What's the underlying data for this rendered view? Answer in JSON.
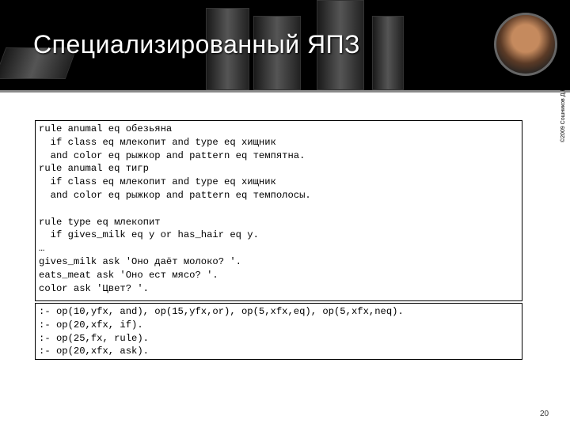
{
  "slide": {
    "title": "Специализированный ЯПЗ",
    "copyright": "©2009 Сошников Д.В.",
    "page_number": "20"
  },
  "code_block_1": [
    "rule anumal eq обезьяна",
    "  if class eq млекопит and type eq хищник",
    "  and color eq рыжкор and pattern eq темпятна.",
    "rule anumal eq тигр",
    "  if class eq млекопит and type eq хищник",
    "  and color eq рыжкор and pattern eq темполосы.",
    "",
    "rule type eq млекопит",
    "  if gives_milk eq y or has_hair eq y.",
    "…",
    "gives_milk ask 'Оно даёт молоко? '.",
    "eats_meat ask 'Оно ест мясо? '.",
    "color ask 'Цвет? '."
  ],
  "code_block_2": [
    ":- op(10,yfx, and), op(15,yfx,or), op(5,xfx,eq), op(5,xfx,neq).",
    ":- op(20,xfx, if).",
    ":- op(25,fx, rule).",
    ":- op(20,xfx, ask)."
  ]
}
